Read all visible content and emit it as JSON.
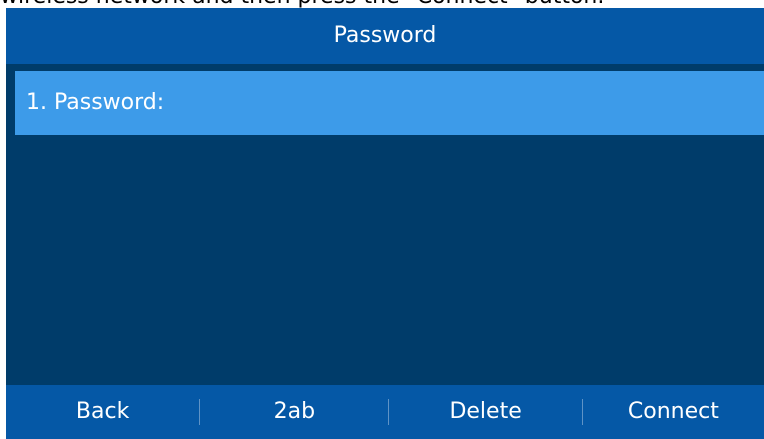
{
  "caption": "wireless network and then press the \"Connect\" button.",
  "screen": {
    "title": "Password",
    "fields": [
      {
        "number": "1.",
        "label": "Password:",
        "value": ""
      }
    ],
    "softkeys": [
      "Back",
      "2ab",
      "Delete",
      "Connect"
    ]
  },
  "colors": {
    "titlebar": "#0558a6",
    "background": "#003c6a",
    "selected_row": "#3d9be9",
    "softkey_bar": "#0558a6",
    "text": "#ffffff"
  }
}
